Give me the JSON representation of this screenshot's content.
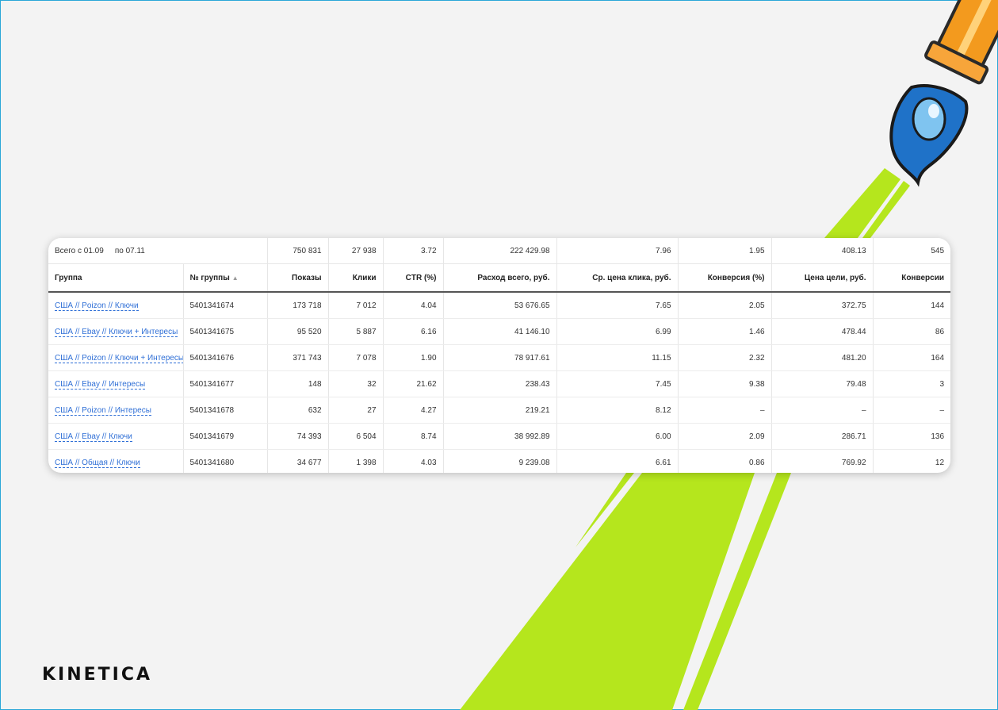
{
  "summary": {
    "period_from": "Всего с 01.09",
    "period_to": "по 07.11",
    "values": [
      "750 831",
      "27 938",
      "3.72",
      "222 429.98",
      "7.96",
      "1.95",
      "408.13",
      "545"
    ]
  },
  "columns": [
    "Группа",
    "№ группы",
    "Показы",
    "Клики",
    "CTR (%)",
    "Расход всего, руб.",
    "Ср. цена клика, руб.",
    "Конверсия (%)",
    "Цена цели, руб.",
    "Конверсии"
  ],
  "sort_indicator": "▲",
  "rows": [
    {
      "group": "США // Poizon // Ключи",
      "id": "5401341674",
      "shows": "173 718",
      "clicks": "7 012",
      "ctr": "4.04",
      "spend": "53 676.65",
      "cpc": "7.65",
      "conv_rate": "2.05",
      "cpa": "372.75",
      "conversions": "144"
    },
    {
      "group": "США // Ebay // Ключи + Интересы",
      "id": "5401341675",
      "shows": "95 520",
      "clicks": "5 887",
      "ctr": "6.16",
      "spend": "41 146.10",
      "cpc": "6.99",
      "conv_rate": "1.46",
      "cpa": "478.44",
      "conversions": "86"
    },
    {
      "group": "США // Poizon // Ключи + Интересы",
      "id": "5401341676",
      "shows": "371 743",
      "clicks": "7 078",
      "ctr": "1.90",
      "spend": "78 917.61",
      "cpc": "11.15",
      "conv_rate": "2.32",
      "cpa": "481.20",
      "conversions": "164"
    },
    {
      "group": "США // Ebay // Интересы",
      "id": "5401341677",
      "shows": "148",
      "clicks": "32",
      "ctr": "21.62",
      "spend": "238.43",
      "cpc": "7.45",
      "conv_rate": "9.38",
      "cpa": "79.48",
      "conversions": "3"
    },
    {
      "group": "США // Poizon // Интересы",
      "id": "5401341678",
      "shows": "632",
      "clicks": "27",
      "ctr": "4.27",
      "spend": "219.21",
      "cpc": "8.12",
      "conv_rate": "–",
      "cpa": "–",
      "conversions": "–"
    },
    {
      "group": "США // Ebay // Ключи",
      "id": "5401341679",
      "shows": "74 393",
      "clicks": "6 504",
      "ctr": "8.74",
      "spend": "38 992.89",
      "cpc": "6.00",
      "conv_rate": "2.09",
      "cpa": "286.71",
      "conversions": "136"
    },
    {
      "group": "США // Общая // Ключи",
      "id": "5401341680",
      "shows": "34 677",
      "clicks": "1 398",
      "ctr": "4.03",
      "spend": "9 239.08",
      "cpc": "6.61",
      "conv_rate": "0.86",
      "cpa": "769.92",
      "conversions": "12"
    }
  ],
  "brand": {
    "logo_text": "KINETICA"
  },
  "colors": {
    "accent_green": "#b5e61d",
    "link_blue": "#2f6fd6",
    "frame_blue": "#2aa7d8",
    "pen_orange": "#f39a1e",
    "flame_blue": "#1f72c8"
  },
  "icons": {
    "sort": "sort-ascending-icon",
    "illustration": "rocket-pen-icon"
  }
}
